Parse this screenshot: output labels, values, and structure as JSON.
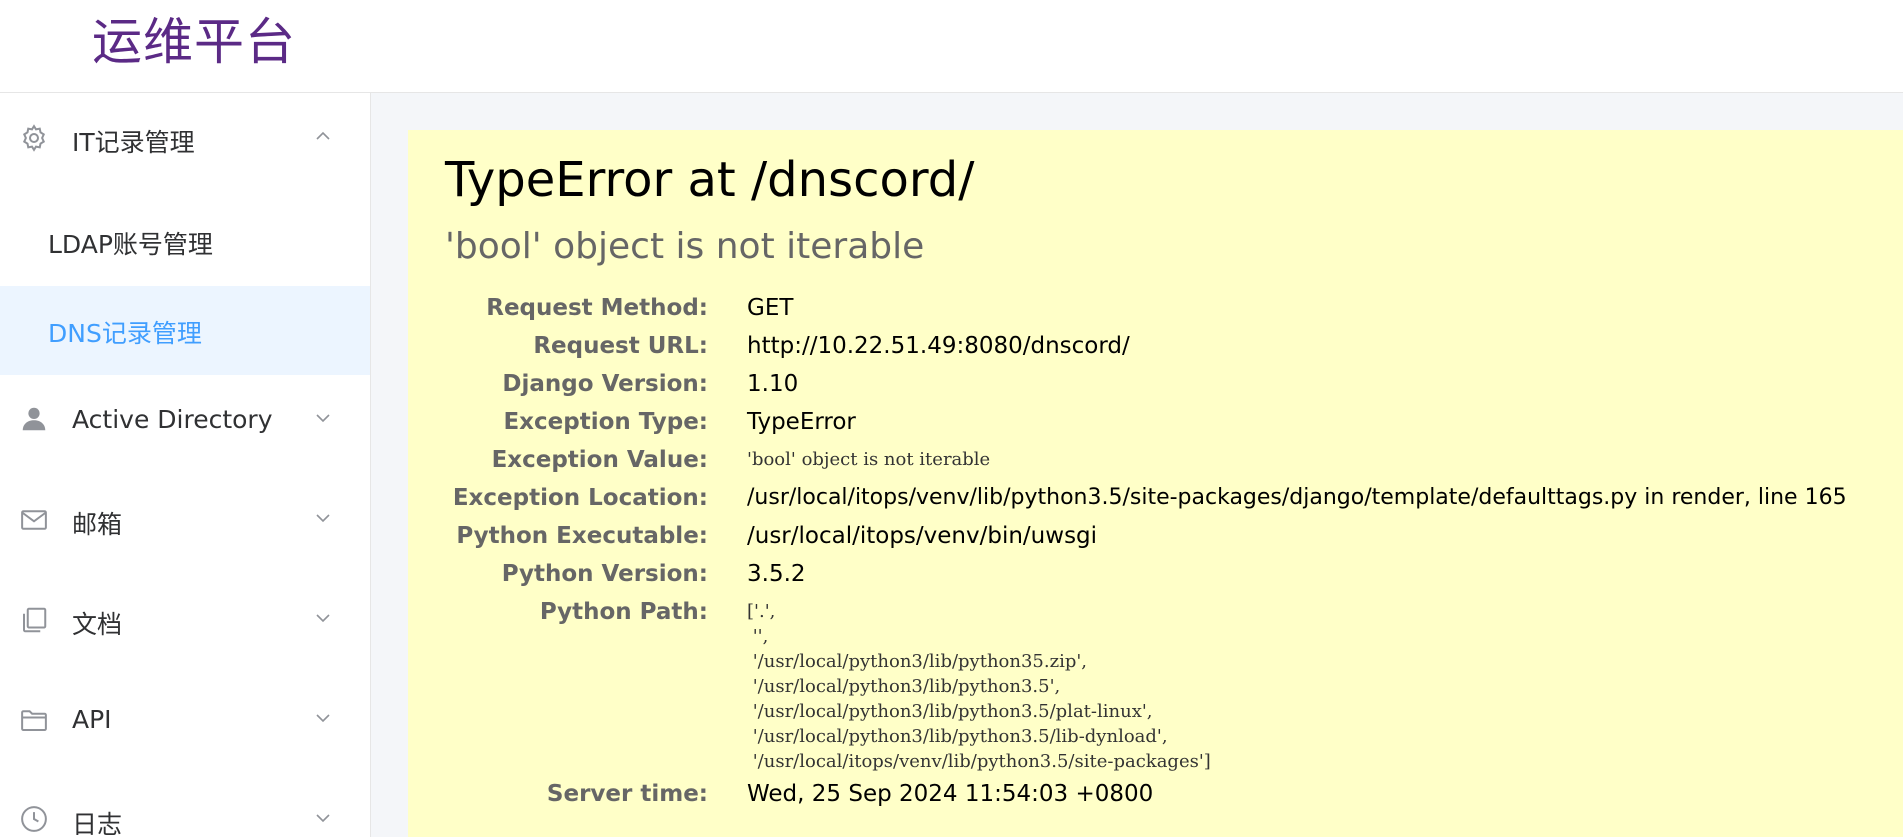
{
  "header": {
    "brand": "运维平台"
  },
  "sidebar": {
    "groups": [
      {
        "label": "IT记录管理",
        "icon": "gear-icon",
        "expanded": true,
        "children": [
          {
            "label": "LDAP账号管理",
            "active": false
          },
          {
            "label": "DNS记录管理",
            "active": true
          }
        ]
      },
      {
        "label": "Active Directory",
        "icon": "user-icon",
        "expanded": false
      },
      {
        "label": "邮箱",
        "icon": "mail-icon",
        "expanded": false
      },
      {
        "label": "文档",
        "icon": "copy-document-icon",
        "expanded": false
      },
      {
        "label": "API",
        "icon": "folder-icon",
        "expanded": false
      },
      {
        "label": "日志",
        "icon": "clock-icon",
        "expanded": false
      }
    ]
  },
  "error": {
    "title": "TypeError at /dnscord/",
    "subtitle": "'bool' object is not iterable",
    "fields": [
      {
        "key": "Request Method:",
        "value": "GET"
      },
      {
        "key": "Request URL:",
        "value": "http://10.22.51.49:8080/dnscord/"
      },
      {
        "key": "Django Version:",
        "value": "1.10"
      },
      {
        "key": "Exception Type:",
        "value": "TypeError"
      },
      {
        "key": "Exception Value:",
        "value": "'bool' object is not iterable"
      },
      {
        "key": "Exception Location:",
        "value": "/usr/local/itops/venv/lib/python3.5/site-packages/django/template/defaulttags.py in render, line 165"
      },
      {
        "key": "Python Executable:",
        "value": "/usr/local/itops/venv/bin/uwsgi"
      },
      {
        "key": "Python Version:",
        "value": "3.5.2"
      },
      {
        "key": "Python Path:",
        "value": "['.',\n '',\n '/usr/local/python3/lib/python35.zip',\n '/usr/local/python3/lib/python3.5',\n '/usr/local/python3/lib/python3.5/plat-linux',\n '/usr/local/python3/lib/python3.5/lib-dynload',\n '/usr/local/itops/venv/lib/python3.5/site-packages']"
      },
      {
        "key": "Server time:",
        "value": "Wed, 25 Sep 2024 11:54:03 +0800"
      }
    ]
  },
  "colors": {
    "brand": "#5b2a86",
    "active_text": "#409eff",
    "active_bg": "#ecf5ff",
    "panel_bg": "#ffffc8"
  }
}
